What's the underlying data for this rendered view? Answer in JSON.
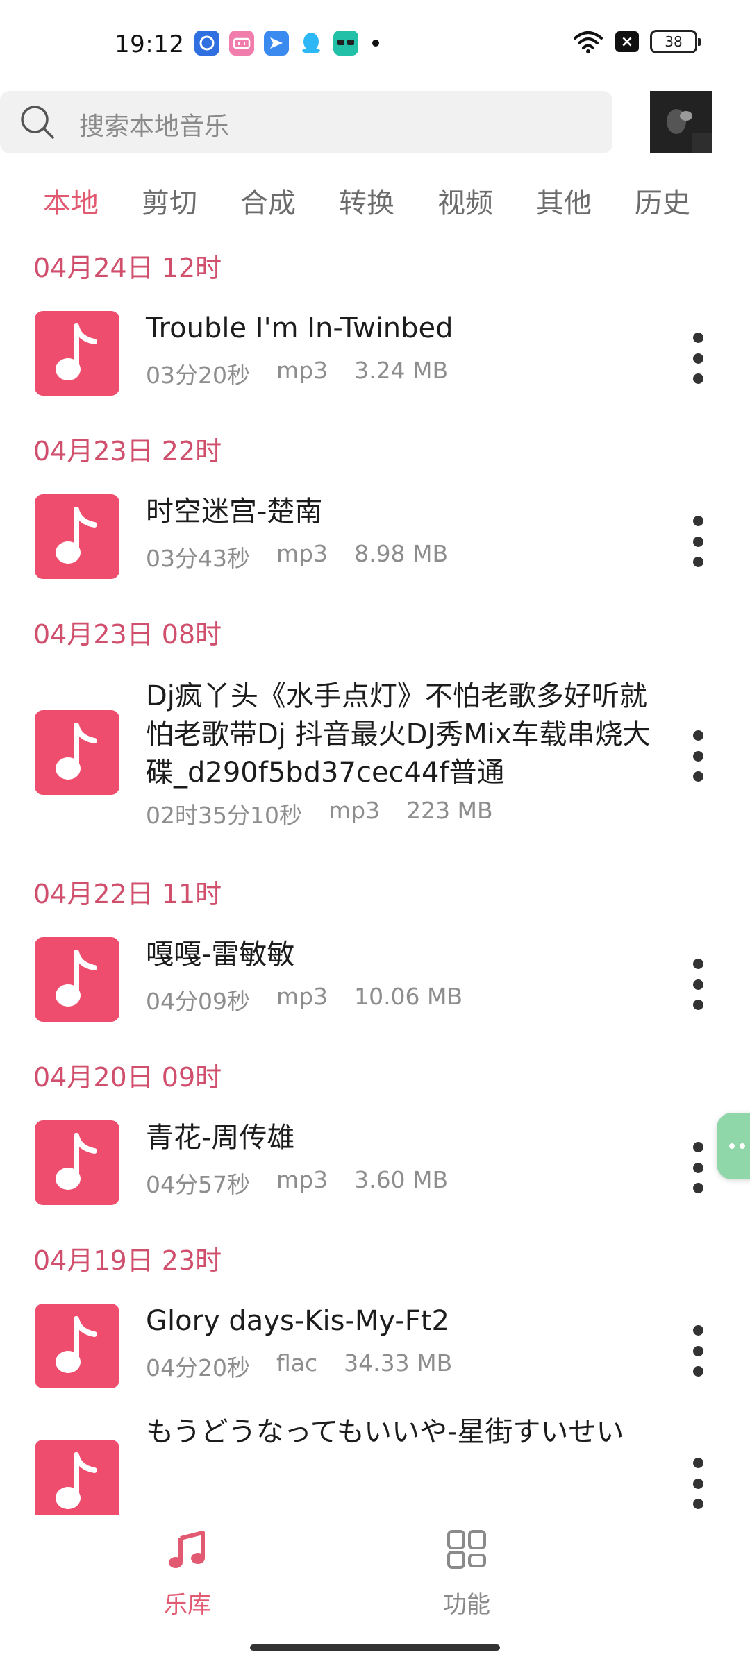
{
  "status_bar": {
    "time": "19:12",
    "battery": "38",
    "apps": [
      {
        "icon": "bank-app-icon",
        "color": "#2f6fe0"
      },
      {
        "icon": "bilibili-app-icon",
        "color": "#f07dab"
      },
      {
        "icon": "flyer-app-icon",
        "color": "#3a8af0"
      },
      {
        "icon": "qq-app-icon",
        "color": "#2db7f5"
      },
      {
        "icon": "magic-app-icon",
        "color": "#23c0a8"
      }
    ]
  },
  "search": {
    "placeholder": "搜索本地音乐"
  },
  "tabs": [
    {
      "label": "本地",
      "active": true
    },
    {
      "label": "剪切"
    },
    {
      "label": "合成"
    },
    {
      "label": "转换"
    },
    {
      "label": "视频"
    },
    {
      "label": "其他"
    },
    {
      "label": "历史"
    }
  ],
  "groups": [
    {
      "date": "04月24日  12时",
      "items": [
        {
          "title": "Trouble I'm In-Twinbed",
          "duration": "03分20秒",
          "format": "mp3",
          "size": "3.24 MB"
        }
      ]
    },
    {
      "date": "04月23日  22时",
      "items": [
        {
          "title": "时空迷宫-楚南",
          "duration": "03分43秒",
          "format": "mp3",
          "size": "8.98 MB"
        }
      ]
    },
    {
      "date": "04月23日  08时",
      "items": [
        {
          "title": "Dj疯丫头《水手点灯》不怕老歌多好听就怕老歌带Dj 抖音最火DJ秀Mix车载串烧大碟_d290f5bd37cec44f普通",
          "duration": "02时35分10秒",
          "format": "mp3",
          "size": "223 MB"
        }
      ]
    },
    {
      "date": "04月22日  11时",
      "items": [
        {
          "title": "嘎嘎-雷敏敏",
          "duration": "04分09秒",
          "format": "mp3",
          "size": "10.06 MB"
        }
      ]
    },
    {
      "date": "04月20日  09时",
      "items": [
        {
          "title": "青花-周传雄",
          "duration": "04分57秒",
          "format": "mp3",
          "size": "3.60 MB"
        }
      ]
    },
    {
      "date": "04月19日  23时",
      "items": [
        {
          "title": "Glory days-Kis-My-Ft2",
          "duration": "04分20秒",
          "format": "flac",
          "size": "34.33 MB"
        },
        {
          "title": "もうどうなってもいいや-星街すいせい",
          "duration": "",
          "format": "",
          "size": ""
        }
      ]
    }
  ],
  "bottom_nav": [
    {
      "label": "乐库",
      "icon": "music-note-icon",
      "active": true
    },
    {
      "label": "功能",
      "icon": "grid-icon",
      "active": false
    }
  ],
  "colors": {
    "accent": "#e15a72",
    "thumb": "#ee4d6d",
    "float_button": "#8fd6a9"
  }
}
